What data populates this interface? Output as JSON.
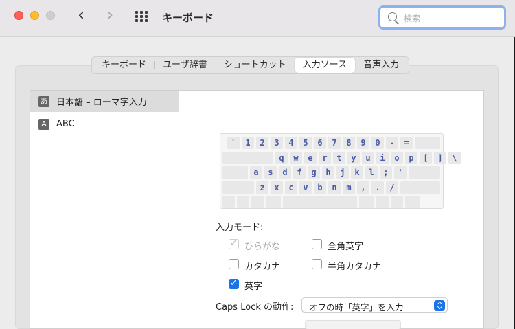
{
  "window": {
    "title": "キーボード",
    "back_glyph": "‹",
    "forward_glyph": "›",
    "search_placeholder": "検索"
  },
  "tabs": [
    {
      "label": "キーボード",
      "active": false
    },
    {
      "label": "ユーザ辞書",
      "active": false
    },
    {
      "label": "ショートカット",
      "active": false
    },
    {
      "label": "入力ソース",
      "active": true
    },
    {
      "label": "音声入力",
      "active": false
    }
  ],
  "input_sources": [
    {
      "badge": "あ",
      "label": "日本語 – ローマ字入力",
      "selected": true
    },
    {
      "badge": "A",
      "label": "ABC",
      "selected": false
    }
  ],
  "keyboard_rows": [
    [
      "`",
      "1",
      "2",
      "3",
      "4",
      "5",
      "6",
      "7",
      "8",
      "9",
      "0",
      "-",
      "="
    ],
    [
      "q",
      "w",
      "e",
      "r",
      "t",
      "y",
      "u",
      "i",
      "o",
      "p",
      "[",
      "]",
      "\\"
    ],
    [
      "a",
      "s",
      "d",
      "f",
      "g",
      "h",
      "j",
      "k",
      "l",
      ";",
      "'"
    ],
    [
      "z",
      "x",
      "c",
      "v",
      "b",
      "n",
      "m",
      ",",
      ".",
      "/"
    ]
  ],
  "input_mode": {
    "label": "入力モード:",
    "options": [
      {
        "label": "ひらがな",
        "checked": true,
        "disabled": true
      },
      {
        "label": "全角英字",
        "checked": false,
        "disabled": false
      },
      {
        "label": "カタカナ",
        "checked": false,
        "disabled": false
      },
      {
        "label": "半角カタカナ",
        "checked": false,
        "disabled": false
      },
      {
        "label": "英字",
        "checked": true,
        "disabled": false
      }
    ]
  },
  "caps_lock": {
    "label": "Caps Lock の動作:",
    "value": "オフの時「英字」を入力"
  },
  "colors": {
    "accent": "#1a74e8",
    "key_text": "#4a5ba5"
  }
}
